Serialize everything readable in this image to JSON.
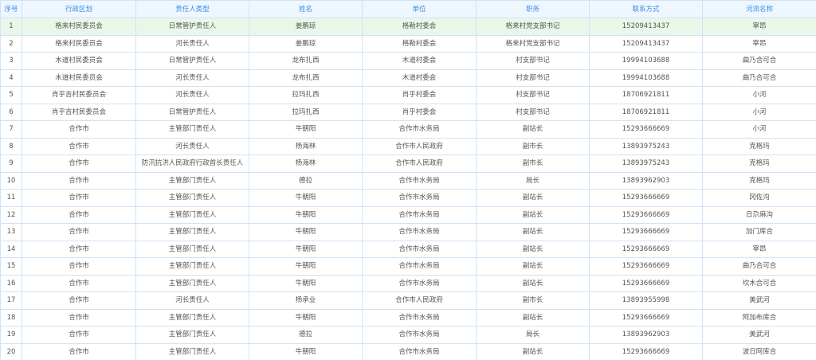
{
  "columns": [
    "序号",
    "行政区划",
    "责任人类型",
    "姓名",
    "单位",
    "职务",
    "联系方式",
    "河流名称"
  ],
  "rows": [
    [
      "1",
      "格来村民委员会",
      "日常管护责任人",
      "姜鹏琼",
      "格勒村委会",
      "格来村党支部书记",
      "15209413437",
      "宰昂"
    ],
    [
      "2",
      "格来村民委员会",
      "河长责任人",
      "姜鹏琼",
      "格勒村委会",
      "格来村党支部书记",
      "15209413437",
      "宰昂"
    ],
    [
      "3",
      "木道村民委员会",
      "日常管护责任人",
      "龙布扎西",
      "木道村委会",
      "村支部书记",
      "19994103688",
      "曲乃合可合"
    ],
    [
      "4",
      "木道村民委员会",
      "河长责任人",
      "龙布扎西",
      "木道村委会",
      "村支部书记",
      "19994103688",
      "曲乃合可合"
    ],
    [
      "5",
      "肖乎吉村民委员会",
      "河长责任人",
      "拉玛扎西",
      "肖乎村委会",
      "村支部书记",
      "18706921811",
      "小河"
    ],
    [
      "6",
      "肖乎吉村民委员会",
      "日常管护责任人",
      "拉玛扎西",
      "肖乎村委会",
      "村支部书记",
      "18706921811",
      "小河"
    ],
    [
      "7",
      "合作市",
      "主管部门责任人",
      "牛朝阳",
      "合作市水务局",
      "副站长",
      "15293666669",
      "小河"
    ],
    [
      "8",
      "合作市",
      "河长责任人",
      "杨海林",
      "合作市人民政府",
      "副市长",
      "13893975243",
      "克格玛"
    ],
    [
      "9",
      "合作市",
      "防汛抗洪人民政府行政首长责任人",
      "杨海林",
      "合作市人民政府",
      "副市长",
      "13893975243",
      "克格玛"
    ],
    [
      "10",
      "合作市",
      "主管部门责任人",
      "德拉",
      "合作市水务局",
      "局长",
      "13893962903",
      "克格玛"
    ],
    [
      "11",
      "合作市",
      "主管部门责任人",
      "牛朝阳",
      "合作市水务局",
      "副站长",
      "15293666669",
      "冈佐沟"
    ],
    [
      "12",
      "合作市",
      "主管部门责任人",
      "牛朝阳",
      "合作市水务局",
      "副站长",
      "15293666669",
      "日尕麻沟"
    ],
    [
      "13",
      "合作市",
      "主管部门责任人",
      "牛朝阳",
      "合作市水务局",
      "副站长",
      "15293666669",
      "加门库合"
    ],
    [
      "14",
      "合作市",
      "主管部门责任人",
      "牛朝阳",
      "合作市水务局",
      "副站长",
      "15293666669",
      "宰昂"
    ],
    [
      "15",
      "合作市",
      "主管部门责任人",
      "牛朝阳",
      "合作市水务局",
      "副站长",
      "15293666669",
      "曲乃合可合"
    ],
    [
      "16",
      "合作市",
      "主管部门责任人",
      "牛朝阳",
      "合作市水务局",
      "副站长",
      "15293666669",
      "坎木合可合"
    ],
    [
      "17",
      "合作市",
      "河长责任人",
      "杨承业",
      "合作市人民政府",
      "副市长",
      "13893955998",
      "美武河"
    ],
    [
      "18",
      "合作市",
      "主管部门责任人",
      "牛朝阳",
      "合作市水务局",
      "副站长",
      "15293666669",
      "阿加布库合"
    ],
    [
      "19",
      "合作市",
      "主管部门责任人",
      "德拉",
      "合作市水务局",
      "局长",
      "13893962903",
      "美武河"
    ],
    [
      "20",
      "合作市",
      "主管部门责任人",
      "牛朝阳",
      "合作市水务局",
      "副站长",
      "15293666669",
      "波日阿库合"
    ]
  ],
  "selected_row": 0,
  "colors": {
    "header_text": "#3a8ee6",
    "header_bg": "#eef6fe",
    "border": "#cfe3f7",
    "selected_bg": "#eaf7e8",
    "cell_text": "#555555"
  }
}
